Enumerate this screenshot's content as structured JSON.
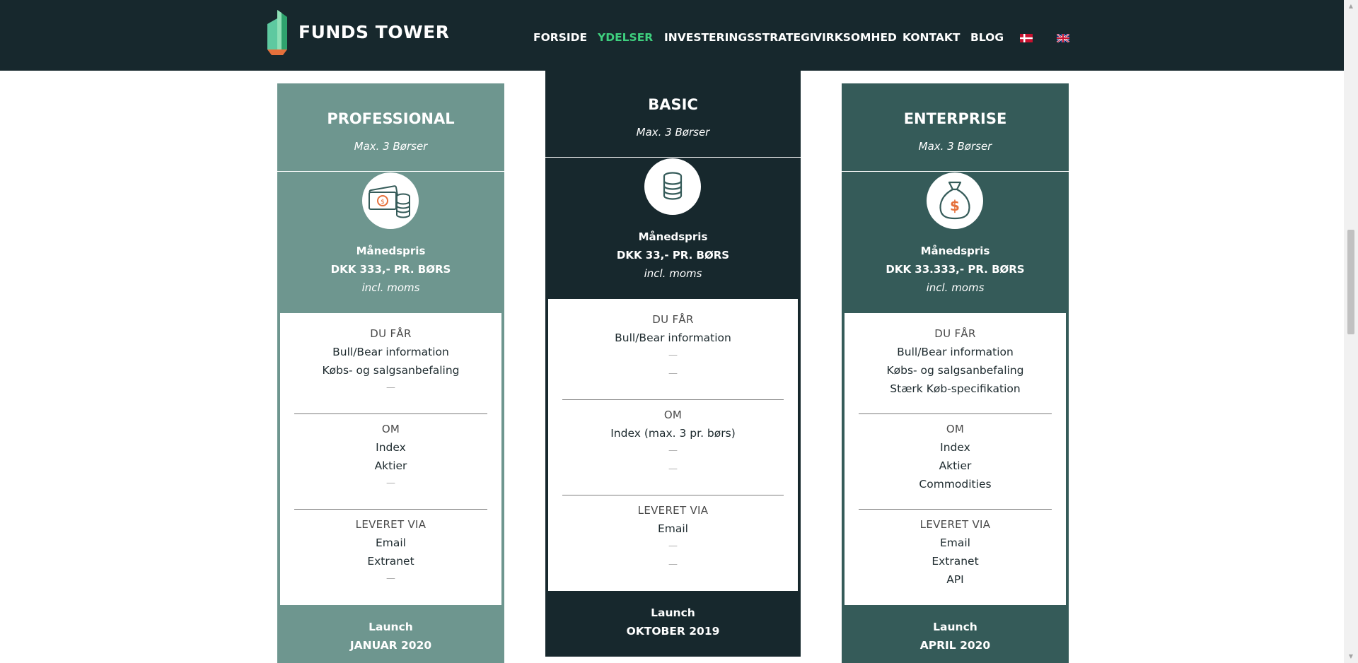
{
  "header": {
    "logo_text": "FUNDS TOWER",
    "nav": [
      "FORSIDE",
      "YDELSER",
      "INVESTERINGSSTRATEGI",
      "VIRKSOMHED",
      "KONTAKT",
      "BLOG"
    ],
    "active_nav": "YDELSER",
    "flags": [
      "danish-flag-icon",
      "uk-flag-icon"
    ]
  },
  "colors": {
    "header_bg": "#17282d",
    "active_nav": "#3ecf7e",
    "professional_bg": "#6e968f",
    "basic_bg": "#17282d",
    "enterprise_bg": "#355b59",
    "icon_orange": "#e5703b"
  },
  "plans": {
    "professional": {
      "title": "PROFESSIONAL",
      "subtitle": "Max. 3 Børser",
      "icon": "cash-and-coins-icon",
      "price_label": "Månedspris",
      "price": "DKK 333,- PR. BØRS",
      "price_note": "incl. moms",
      "you_get_heading": "DU FÅR",
      "you_get": [
        "Bull/Bear information",
        "Købs- og salgsanbefaling",
        "—"
      ],
      "about_heading": "OM",
      "about": [
        "Index",
        "Aktier",
        "—"
      ],
      "delivered_heading": "LEVERET VIA",
      "delivered": [
        "Email",
        "Extranet",
        "—"
      ],
      "launch_label": "Launch",
      "launch_date": "JANUAR 2020"
    },
    "basic": {
      "title": "BASIC",
      "subtitle": "Max. 3 Børser",
      "icon": "coin-stack-icon",
      "price_label": "Månedspris",
      "price": "DKK 33,- PR. BØRS",
      "price_note": "incl. moms",
      "you_get_heading": "DU FÅR",
      "you_get": [
        "Bull/Bear information",
        "—",
        "—"
      ],
      "about_heading": "OM",
      "about": [
        "Index (max. 3 pr. børs)",
        "—",
        "—"
      ],
      "delivered_heading": "LEVERET VIA",
      "delivered": [
        "Email",
        "—",
        "—"
      ],
      "launch_label": "Launch",
      "launch_date": "OKTOBER 2019"
    },
    "enterprise": {
      "title": "ENTERPRISE",
      "subtitle": "Max. 3 Børser",
      "icon": "money-bag-icon",
      "price_label": "Månedspris",
      "price": "DKK 33.333,- PR. BØRS",
      "price_note": "incl. moms",
      "you_get_heading": "DU FÅR",
      "you_get": [
        "Bull/Bear information",
        "Købs- og salgsanbefaling",
        "Stærk Køb-specifikation"
      ],
      "about_heading": "OM",
      "about": [
        "Index",
        "Aktier",
        "Commodities"
      ],
      "delivered_heading": "LEVERET VIA",
      "delivered": [
        "Email",
        "Extranet",
        "API"
      ],
      "launch_label": "Launch",
      "launch_date": "APRIL 2020"
    }
  }
}
